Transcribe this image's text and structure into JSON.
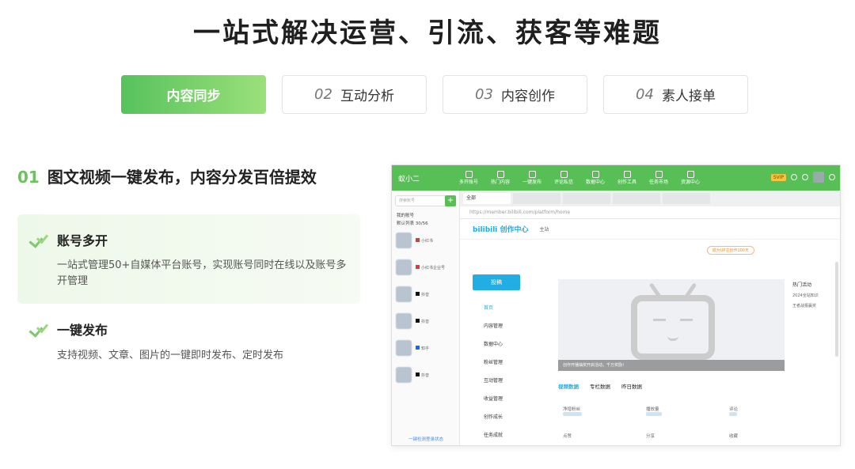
{
  "headline": "一站式解决运营、引流、获客等难题",
  "tabs": [
    {
      "num": "",
      "label": "内容同步",
      "active": true
    },
    {
      "num": "02",
      "label": "互动分析",
      "active": false
    },
    {
      "num": "03",
      "label": "内容创作",
      "active": false
    },
    {
      "num": "04",
      "label": "素人接单",
      "active": false
    }
  ],
  "section": {
    "num": "01",
    "title": "图文视频一键发布，内容分发百倍提效"
  },
  "features": [
    {
      "title": "账号多开",
      "desc": "一站式管理50+自媒体平台账号，实现账号同时在线以及账号多开管理"
    },
    {
      "title": "一键发布",
      "desc": "支持视频、文章、图片的一键即时发布、定时发布"
    }
  ],
  "screenshot": {
    "app_name": "蚁小二",
    "nav": [
      "多开账号",
      "热门内容",
      "一键发布",
      "评论私信",
      "数据中心",
      "创作工具",
      "任务市场",
      "资源中心"
    ],
    "badge": "SVIP",
    "search_placeholder": "搜索账号",
    "add_label": "+",
    "tree": [
      "我的账号",
      "默认列表 30/56"
    ],
    "accounts": [
      "小红书",
      "小红书企业号",
      "抖音",
      "抖音",
      "知乎",
      "抖音"
    ],
    "footer_link": "一键检测登录状态",
    "browser_tab": "全部",
    "url": "https://member.bilibili.com/platform/home",
    "bili_logo": "bilibili 创作中心",
    "bili_home": "主站",
    "bili_pill": "成为UP主创作100天",
    "upload_btn": "投稿",
    "menu": [
      "首页",
      "内容管理",
      "数据中心",
      "粉丝管理",
      "互动管理",
      "收益管理",
      "创作成长",
      "任务成就",
      "必火指南"
    ],
    "banner_caption": "创作开播抽奖开启活动，千万奖励！",
    "hot_title": "热门活动",
    "hot_items": [
      "2024全站知识",
      "王者战报赢奖"
    ],
    "data_tabs": [
      "视频数据",
      "专栏数据",
      "昨日数据"
    ],
    "stats": [
      "净增粉丝",
      "播放量",
      "评论",
      "点赞",
      "分享",
      "收藏"
    ]
  }
}
